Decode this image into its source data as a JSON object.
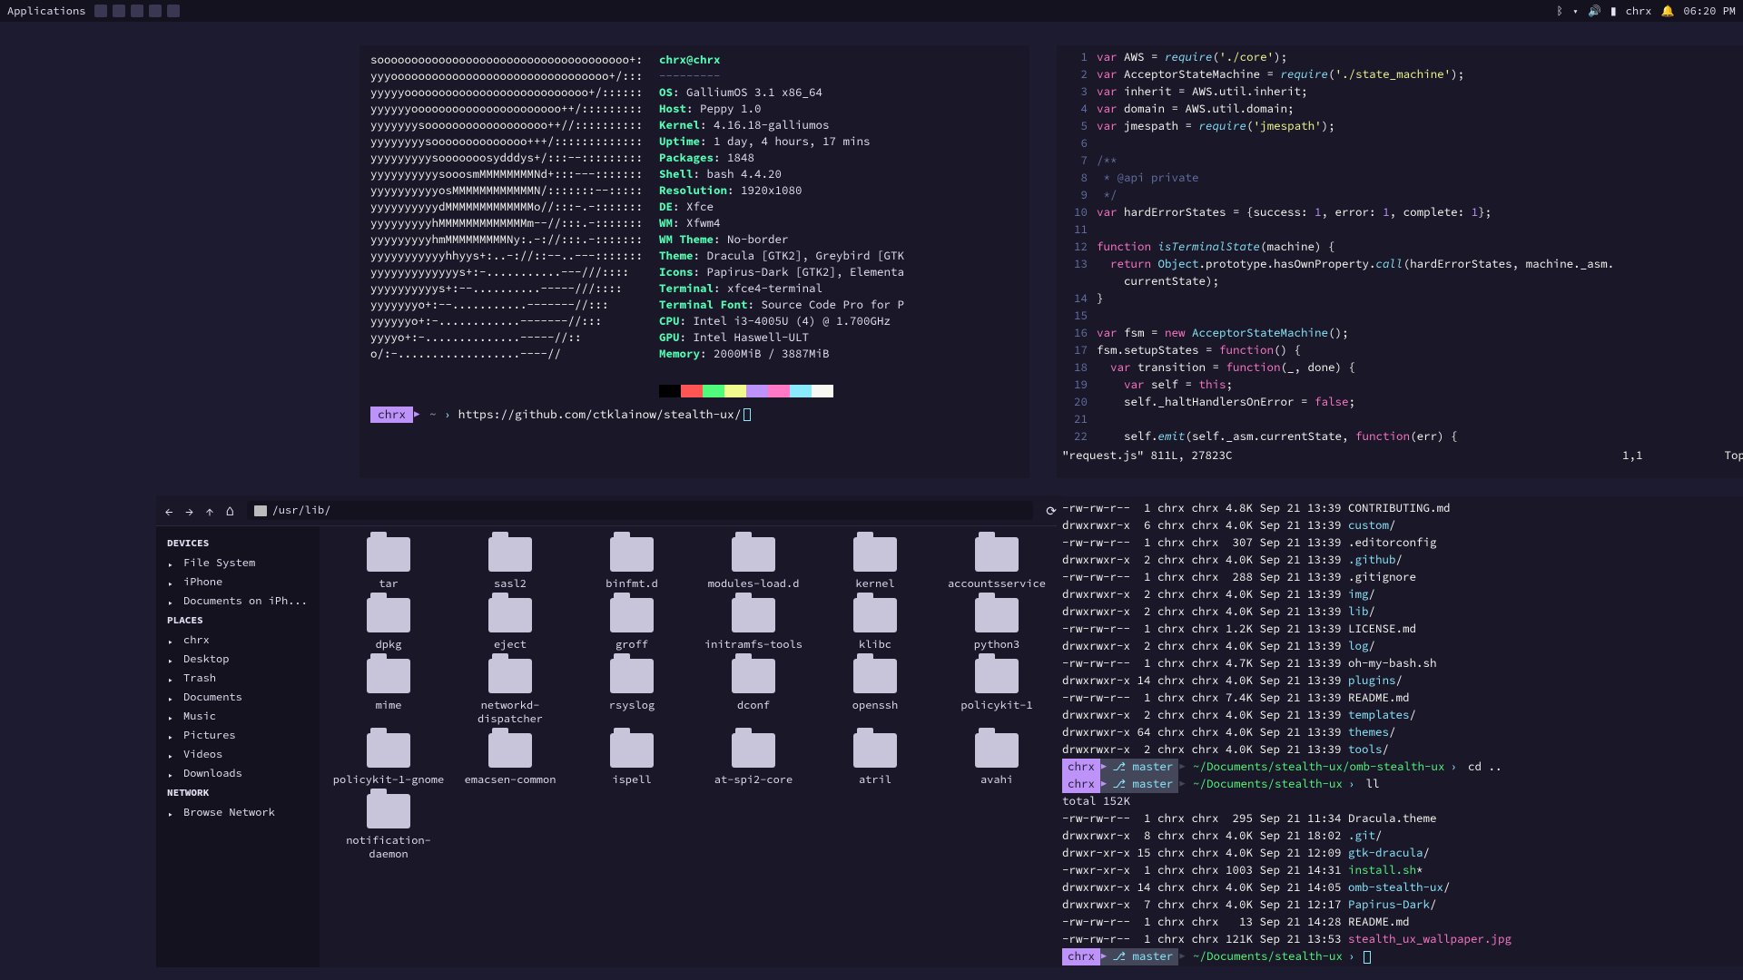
{
  "panel": {
    "applications": "Applications",
    "user": "chrx",
    "time": "06:20 PM",
    "tray_icons": [
      "bluetooth",
      "wifi",
      "volume",
      "battery",
      "notifications"
    ]
  },
  "neofetch": {
    "ascii": "sooooooooooooooooooooooooooooooooooooo+:\nyyyoooooooooooooooooooooooooooooooo+/:::\nyyyyyooooooooooooooooooooooooooo+/::::::\nyyyyyyoooooooooooooooooooooo++/:::::::::\nyyyyyyysoooooooooooooooooo++//::::::::::\nyyyyyyyysoooooooooooooo+++/:::::::::::::\nyyyyyyyyysooooooosydddys+/:::--:::::::::\nyyyyyyyyyysooosmMMMMMMMMNd+:::---:::::::\nyyyyyyyyyyosMMMMMMMMMMMMN/:::::::--:::::\nyyyyyyyyyydMMMMMMMMMMMMMo//:::-.-:::::::\nyyyyyyyyyhMMMMMMMMMMMMMm--//:::.-:::::::\nyyyyyyyyyhmMMMMMMMMMNy:.-://:::.-:::::::\nyyyyyyyyyyyhhyys+:..-://::--..---:::::::\nyyyyyyyyyyyyys+:-...........---///::::\nyyyyyyyyyys+:--..........-----///::::\nyyyyyyyo+:--...........-------//:::\nyyyyyyo+:-............-------//:::\nyyyyo+:-..............-----//::\no/:-..................----//",
    "user_host": "chrx@chrx",
    "dashes": "---------",
    "rows": [
      {
        "k": "OS",
        "v": " GalliumOS 3.1 x86_64"
      },
      {
        "k": "Host",
        "v": " Peppy 1.0"
      },
      {
        "k": "Kernel",
        "v": " 4.16.18-galliumos"
      },
      {
        "k": "Uptime",
        "v": " 1 day, 4 hours, 17 mins"
      },
      {
        "k": "Packages",
        "v": " 1848"
      },
      {
        "k": "Shell",
        "v": " bash 4.4.20"
      },
      {
        "k": "Resolution",
        "v": " 1920x1080"
      },
      {
        "k": "DE",
        "v": " Xfce"
      },
      {
        "k": "WM",
        "v": " Xfwm4"
      },
      {
        "k": "WM Theme",
        "v": " No-border"
      },
      {
        "k": "Theme",
        "v": " Dracula [GTK2], Greybird [GTK"
      },
      {
        "k": "Icons",
        "v": " Papirus-Dark [GTK2], Elementa"
      },
      {
        "k": "Terminal",
        "v": " xfce4-terminal"
      },
      {
        "k": "Terminal Font",
        "v": " Source Code Pro for P"
      },
      {
        "k": "CPU",
        "v": " Intel i3-4005U (4) @ 1.700GHz"
      },
      {
        "k": "GPU",
        "v": " Intel Haswell-ULT"
      },
      {
        "k": "Memory",
        "v": " 2000MiB / 3887MiB"
      }
    ],
    "colors": [
      "#000000",
      "#ff5555",
      "#50fa7b",
      "#f1fa8c",
      "#bd93f9",
      "#ff79c6",
      "#8be9fd",
      "#f8f8f2"
    ],
    "prompt_host": "chrx",
    "prompt_tilde": "~",
    "prompt_arrow": "›",
    "prompt_cmd": "https://github.com/ctklainow/stealth-ux/"
  },
  "vim": {
    "lines": [
      {
        "n": 1,
        "s": [
          {
            "t": "var ",
            "c": "kw"
          },
          {
            "t": "AWS = ",
            "c": "id"
          },
          {
            "t": "require",
            "c": "fn"
          },
          {
            "t": "(",
            "c": "id"
          },
          {
            "t": "'./core'",
            "c": "str"
          },
          {
            "t": ");",
            "c": "id"
          }
        ]
      },
      {
        "n": 2,
        "s": [
          {
            "t": "var ",
            "c": "kw"
          },
          {
            "t": "AcceptorStateMachine = ",
            "c": "id"
          },
          {
            "t": "require",
            "c": "fn"
          },
          {
            "t": "(",
            "c": "id"
          },
          {
            "t": "'./state_machine'",
            "c": "str"
          },
          {
            "t": ");",
            "c": "id"
          }
        ]
      },
      {
        "n": 3,
        "s": [
          {
            "t": "var ",
            "c": "kw"
          },
          {
            "t": "inherit = AWS.util.inherit;",
            "c": "id"
          }
        ]
      },
      {
        "n": 4,
        "s": [
          {
            "t": "var ",
            "c": "kw"
          },
          {
            "t": "domain = AWS.util.domain;",
            "c": "id"
          }
        ]
      },
      {
        "n": 5,
        "s": [
          {
            "t": "var ",
            "c": "kw"
          },
          {
            "t": "jmespath = ",
            "c": "id"
          },
          {
            "t": "require",
            "c": "fn"
          },
          {
            "t": "(",
            "c": "id"
          },
          {
            "t": "'jmespath'",
            "c": "str"
          },
          {
            "t": ");",
            "c": "id"
          }
        ]
      },
      {
        "n": 6,
        "s": []
      },
      {
        "n": 7,
        "s": [
          {
            "t": "/**",
            "c": "cm"
          }
        ]
      },
      {
        "n": 8,
        "s": [
          {
            "t": " * @api private",
            "c": "cm"
          }
        ]
      },
      {
        "n": 9,
        "s": [
          {
            "t": " */",
            "c": "cm"
          }
        ]
      },
      {
        "n": 10,
        "s": [
          {
            "t": "var ",
            "c": "kw"
          },
          {
            "t": "hardErrorStates = {success: ",
            "c": "id"
          },
          {
            "t": "1",
            "c": "num"
          },
          {
            "t": ", error: ",
            "c": "id"
          },
          {
            "t": "1",
            "c": "num"
          },
          {
            "t": ", complete: ",
            "c": "id"
          },
          {
            "t": "1",
            "c": "num"
          },
          {
            "t": "};",
            "c": "id"
          }
        ]
      },
      {
        "n": 11,
        "s": []
      },
      {
        "n": 12,
        "s": [
          {
            "t": "function ",
            "c": "kw"
          },
          {
            "t": "isTerminalState",
            "c": "fn"
          },
          {
            "t": "(machine) {",
            "c": "id"
          }
        ]
      },
      {
        "n": 13,
        "s": [
          {
            "t": "  return ",
            "c": "kw"
          },
          {
            "t": "Object",
            "c": "cl"
          },
          {
            "t": ".prototype.hasOwnProperty.",
            "c": "id"
          },
          {
            "t": "call",
            "c": "fn"
          },
          {
            "t": "(hardErrorStates, machine._asm.",
            "c": "id"
          }
        ]
      },
      {
        "n": 0,
        "pad": "    ",
        "s": [
          {
            "t": "currentState);",
            "c": "id"
          }
        ]
      },
      {
        "n": 14,
        "s": [
          {
            "t": "}",
            "c": "id"
          }
        ]
      },
      {
        "n": 15,
        "s": []
      },
      {
        "n": 16,
        "s": [
          {
            "t": "var ",
            "c": "kw"
          },
          {
            "t": "fsm = ",
            "c": "id"
          },
          {
            "t": "new ",
            "c": "kw"
          },
          {
            "t": "AcceptorStateMachine",
            "c": "cl"
          },
          {
            "t": "();",
            "c": "id"
          }
        ]
      },
      {
        "n": 17,
        "s": [
          {
            "t": "fsm.setupStates = ",
            "c": "id"
          },
          {
            "t": "function",
            "c": "kw"
          },
          {
            "t": "() {",
            "c": "id"
          }
        ]
      },
      {
        "n": 18,
        "s": [
          {
            "t": "  var ",
            "c": "kw"
          },
          {
            "t": "transition = ",
            "c": "id"
          },
          {
            "t": "function",
            "c": "kw"
          },
          {
            "t": "(_, done) {",
            "c": "id"
          }
        ]
      },
      {
        "n": 19,
        "s": [
          {
            "t": "    var ",
            "c": "kw"
          },
          {
            "t": "self = ",
            "c": "id"
          },
          {
            "t": "this",
            "c": "kw"
          },
          {
            "t": ";",
            "c": "id"
          }
        ]
      },
      {
        "n": 20,
        "s": [
          {
            "t": "    self._haltHandlersOnError = ",
            "c": "id"
          },
          {
            "t": "false",
            "c": "kw"
          },
          {
            "t": ";",
            "c": "id"
          }
        ]
      },
      {
        "n": 21,
        "s": []
      },
      {
        "n": 22,
        "s": [
          {
            "t": "    self.",
            "c": "id"
          },
          {
            "t": "emit",
            "c": "fn"
          },
          {
            "t": "(self._asm.currentState, ",
            "c": "id"
          },
          {
            "t": "function",
            "c": "kw"
          },
          {
            "t": "(err) {",
            "c": "id"
          }
        ]
      }
    ],
    "status_left": "\"request.js\" 811L, 27823C",
    "status_mid": "1,1",
    "status_right": "Top"
  },
  "fm": {
    "path": "/usr/lib/",
    "devices_hdr": "DEVICES",
    "devices": [
      "File System",
      "iPhone",
      "Documents on iPh..."
    ],
    "places_hdr": "PLACES",
    "places": [
      "chrx",
      "Desktop",
      "Trash",
      "Documents",
      "Music",
      "Pictures",
      "Videos",
      "Downloads"
    ],
    "network_hdr": "NETWORK",
    "network": [
      "Browse Network"
    ],
    "folders": [
      "tar",
      "sasl2",
      "binfmt.d",
      "modules-load.d",
      "kernel",
      "accountsservice",
      "dpkg",
      "eject",
      "groff",
      "initramfs-tools",
      "klibc",
      "python3",
      "mime",
      "networkd-dispatcher",
      "rsyslog",
      "dconf",
      "openssh",
      "policykit-1",
      "policykit-1-gnome",
      "emacsen-common",
      "ispell",
      "at-spi2-core",
      "atril",
      "avahi",
      "notification-daemon"
    ]
  },
  "ls": {
    "top": [
      "-rw-rw-r--  1 chrx chrx 4.8K Sep 21 13:39 CONTRIBUTING.md",
      "drwxrwxr-x  6 chrx chrx 4.0K Sep 21 13:39 |custom|/",
      "-rw-rw-r--  1 chrx chrx  307 Sep 21 13:39 .editorconfig",
      "drwxrwxr-x  2 chrx chrx 4.0K Sep 21 13:39 |.github|/",
      "-rw-rw-r--  1 chrx chrx  288 Sep 21 13:39 .gitignore",
      "drwxrwxr-x  2 chrx chrx 4.0K Sep 21 13:39 |img|/",
      "drwxrwxr-x  2 chrx chrx 4.0K Sep 21 13:39 |lib|/",
      "-rw-rw-r--  1 chrx chrx 1.2K Sep 21 13:39 LICENSE.md",
      "drwxrwxr-x  2 chrx chrx 4.0K Sep 21 13:39 |log|/",
      "-rw-rw-r--  1 chrx chrx 4.7K Sep 21 13:39 oh-my-bash.sh",
      "drwxrwxr-x 14 chrx chrx 4.0K Sep 21 13:39 |plugins|/",
      "-rw-rw-r--  1 chrx chrx 7.4K Sep 21 13:39 README.md",
      "drwxrwxr-x  2 chrx chrx 4.0K Sep 21 13:39 |templates|/",
      "drwxrwxr-x 64 chrx chrx 4.0K Sep 21 13:39 |themes|/",
      "drwxrwxr-x  2 chrx chrx 4.0K Sep 21 13:39 |tools|/"
    ],
    "p1_host": "chrx",
    "p1_branch": "⎇ master",
    "p1_path": "~/Documents/stealth-ux/omb-stealth-ux",
    "p1_cmd": "cd ..",
    "p2_host": "chrx",
    "p2_branch": "⎇ master",
    "p2_path": "~/Documents/stealth-ux",
    "p2_cmd": "ll",
    "total": "total 152K",
    "bot": [
      "-rw-rw-r--  1 chrx chrx  295 Sep 21 11:34 Dracula.theme",
      "drwxrwxr-x  8 chrx chrx 4.0K Sep 21 18:02 |.git|/",
      "drwxr-xr-x 15 chrx chrx 4.0K Sep 21 12:09 |gtk-dracula|/",
      "-rwxr-xr-x  1 chrx chrx 1003 Sep 21 14:31 ^install.sh^*",
      "drwxrwxr-x 14 chrx chrx 4.0K Sep 21 14:05 |omb-stealth-ux|/",
      "drwxrwxr-x  7 chrx chrx 4.0K Sep 21 12:17 |Papirus-Dark|/",
      "-rw-rw-r--  1 chrx chrx   13 Sep 21 14:28 README.md",
      "-rw-rw-r--  1 chrx chrx 121K Sep 21 13:53 ~stealth_ux_wallpaper.jpg~"
    ],
    "p3_host": "chrx",
    "p3_branch": "⎇ master",
    "p3_path": "~/Documents/stealth-ux"
  }
}
